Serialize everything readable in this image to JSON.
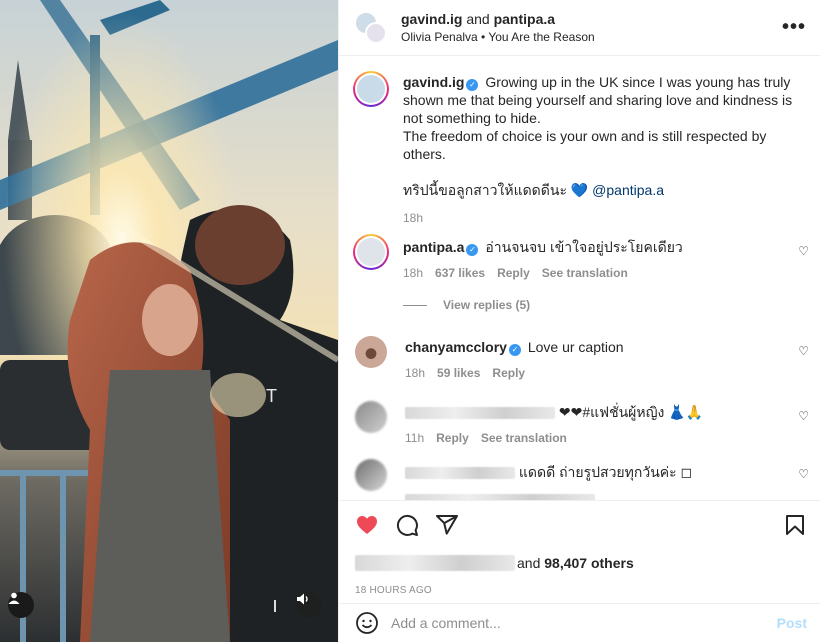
{
  "header": {
    "user1": "gavind.ig",
    "joiner": "and",
    "user2": "pantipa.a",
    "audio": "Olivia Penalva • You Are the Reason",
    "more": "•••"
  },
  "caption": {
    "username": "gavind.ig",
    "text": "Growing up in the UK since I was young has truly shown me that being yourself and sharing love and kindness is not something to hide.",
    "text2": "The freedom of choice is your own and is still respected by others.",
    "thai": "ทริปนี้ขอลูกสาวให้แดดดีนะ 💙",
    "mention": "@pantipa.a",
    "time": "18h"
  },
  "comments": [
    {
      "username": "pantipa.a",
      "verified": true,
      "text": "อ่านจนจบ เข้าใจอยู่ประโยคเดียว",
      "time": "18h",
      "likes": "637 likes",
      "reply": "Reply",
      "translate": "See translation"
    },
    {
      "username": "chanyamcclory",
      "verified": true,
      "text": "Love ur caption",
      "time": "18h",
      "likes": "59 likes",
      "reply": "Reply"
    },
    {
      "username": "",
      "verified": false,
      "text": "❤❤#แฟชั่นผู้หญิง 👗🙏",
      "time": "11h",
      "reply": "Reply",
      "translate": "See translation"
    },
    {
      "username": "",
      "verified": false,
      "text": "แดดดี ถ่ายรูปสวยทุกวันค่ะ ◻",
      "time": "",
      "reply": ""
    }
  ],
  "view_replies": "View replies (5)",
  "likes": {
    "prefix": "and",
    "count": "98,407 others"
  },
  "timestamp": "18 HOURS AGO",
  "add_comment": {
    "placeholder": "Add a comment...",
    "post": "Post"
  },
  "colors": {
    "heart": "#ed4956",
    "link": "#00376b",
    "verified": "#3897f0",
    "post_disabled": "#b2dffc"
  }
}
